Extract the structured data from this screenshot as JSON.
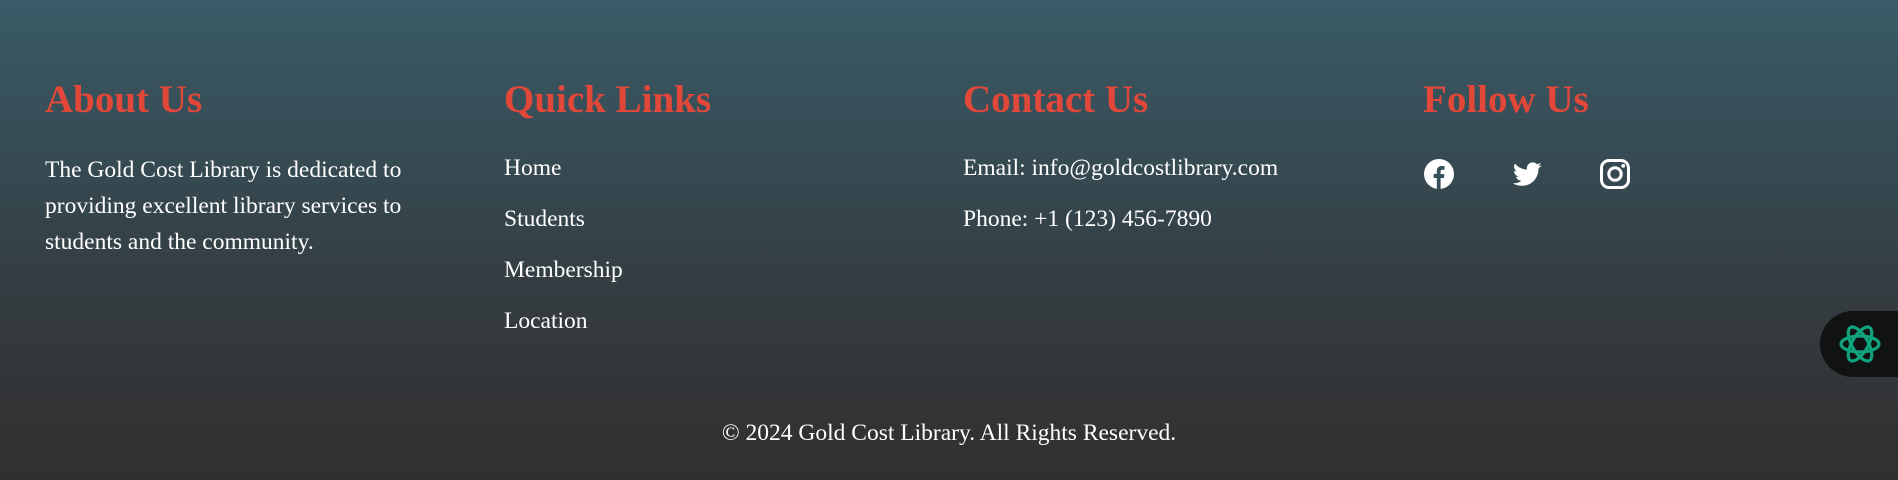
{
  "footer": {
    "about": {
      "heading": "About Us",
      "text": "The Gold Cost Library is dedicated to providing excellent library services to students and the community."
    },
    "quick_links": {
      "heading": "Quick Links",
      "items": [
        {
          "label": "Home"
        },
        {
          "label": "Students"
        },
        {
          "label": "Membership"
        },
        {
          "label": "Location"
        }
      ]
    },
    "contact": {
      "heading": "Contact Us",
      "email": "Email: info@goldcostlibrary.com",
      "phone": "Phone: +1 (123) 456-7890"
    },
    "follow": {
      "heading": "Follow Us",
      "icons": [
        "facebook-icon",
        "twitter-icon",
        "instagram-icon"
      ]
    },
    "copyright": "© 2024 Gold Cost Library. All Rights Reserved."
  },
  "assistant_button": {
    "icon": "ai-assistant-icon"
  },
  "colors": {
    "heading": "#e2483a",
    "text": "#ffffff",
    "gradient_top": "#395b67",
    "gradient_bottom": "#322f2f",
    "assistant_bg": "#111312",
    "assistant_icon": "#10a37f"
  }
}
